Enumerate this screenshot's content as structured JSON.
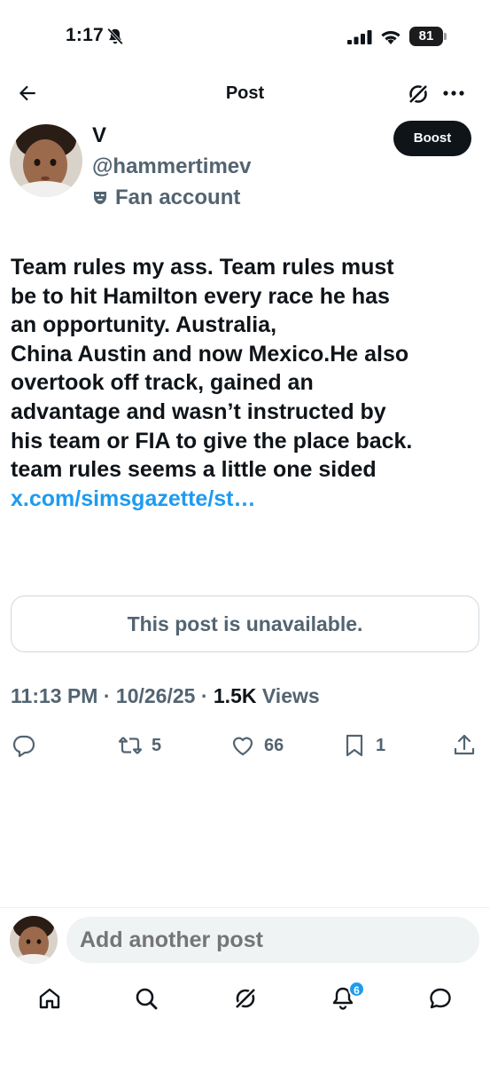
{
  "status_bar": {
    "time": "1:17",
    "battery": "81"
  },
  "header": {
    "title": "Post"
  },
  "author": {
    "display_name": "V",
    "handle": "@hammertimev",
    "affiliation": "Fan account",
    "boost_label": "Boost"
  },
  "post": {
    "lines": [
      "Team rules my ass. Team rules must",
      "be to hit Hamilton every race he has",
      "an opportunity. Australia,",
      "China Austin and now Mexico.He also",
      "overtook off track, gained an",
      "advantage and wasn’t instructed by",
      "his team or FIA to give the place back.",
      "team rules seems a little one sided"
    ],
    "link": "x.com/simsgazette/st…",
    "quote_unavailable": "This post is unavailable.",
    "time": "11:13 PM",
    "date": "10/26/25",
    "views_count": "1.5K",
    "views_label": "Views"
  },
  "actions": {
    "reposts": "5",
    "likes": "66",
    "bookmarks": "1"
  },
  "composer": {
    "placeholder": "Add another post"
  },
  "tabbar": {
    "notification_badge": "6"
  },
  "icons": [
    "bell-slash-icon",
    "signal-icon",
    "wifi-icon",
    "back-arrow-icon",
    "grok-icon",
    "more-icon",
    "mask-icon",
    "reply-icon",
    "repost-icon",
    "like-icon",
    "bookmark-icon",
    "share-icon",
    "home-icon",
    "search-icon",
    "bell-icon",
    "messages-icon"
  ],
  "colors": {
    "text": "#0f1419",
    "secondary": "#536471",
    "link": "#1d9bf0",
    "button": "#0f1419",
    "composer_bg": "#eff3f4"
  }
}
